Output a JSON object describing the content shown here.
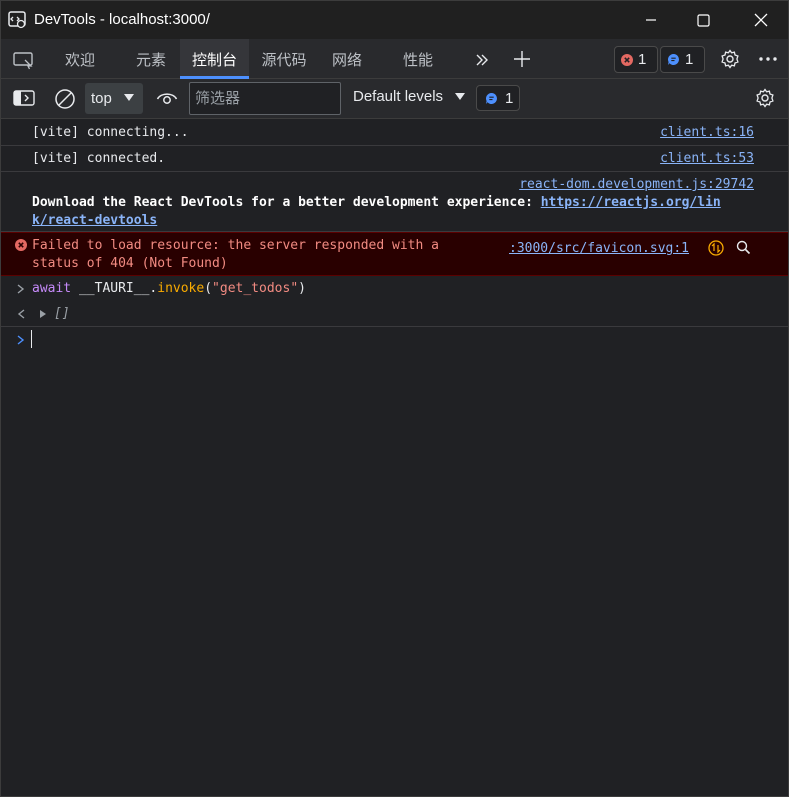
{
  "window": {
    "title": "DevTools - localhost:3000/"
  },
  "tabs": [
    {
      "label": "欢迎",
      "active": false
    },
    {
      "label": "元素",
      "active": false
    },
    {
      "label": "控制台",
      "active": true
    },
    {
      "label": "源代码",
      "active": false
    },
    {
      "label": "网络",
      "active": false
    },
    {
      "label": "性能",
      "active": false
    }
  ],
  "tabbar": {
    "error_count": "1",
    "info_count": "1"
  },
  "toolbar": {
    "context": "top",
    "filter_placeholder": "筛选器",
    "levels_label": "Default levels",
    "issues_count": "1"
  },
  "console": {
    "messages": [
      {
        "text": "[vite] connecting...",
        "source": "client.ts:16"
      },
      {
        "text": "[vite] connected.",
        "source": "client.ts:53"
      },
      {
        "source": "react-dom.development.js:29742",
        "text_bold": "Download the React DevTools for a better development experience: ",
        "link_part1": "https://reactjs.org/lin",
        "link_part2": "k/react-devtools"
      },
      {
        "level": "error",
        "line1": "Failed to load resource: the server responded with a",
        "line2": "status of 404 (Not Found)",
        "source": ":3000/src/favicon.svg:1"
      }
    ],
    "input": {
      "await": "await",
      "obj": "__TAURI__",
      "dot": ".",
      "method": "invoke",
      "paren_open": "(",
      "arg": "\"get_todos\"",
      "paren_close": ")"
    },
    "result": "[]"
  },
  "colors": {
    "accent": "#4d90fe",
    "error_bg": "#290000",
    "error_text": "#f28b82",
    "link": "#8ab4f8"
  }
}
